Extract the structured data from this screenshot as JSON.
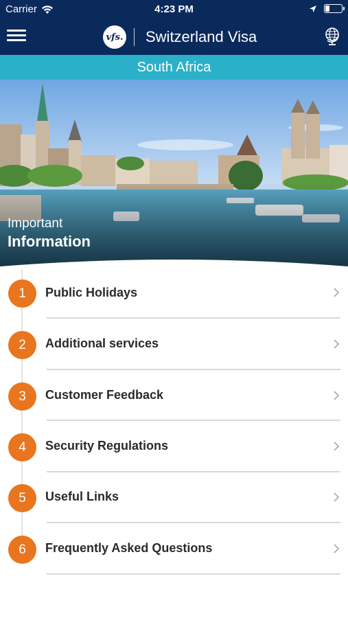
{
  "status_bar": {
    "carrier": "Carrier",
    "time": "4:23 PM"
  },
  "header": {
    "logo_text": "vfs.",
    "title": "Switzerland Visa",
    "menu_icon": "hamburger-menu-icon",
    "globe_icon": "globe-icon"
  },
  "country": "South Africa",
  "hero": {
    "subtitle": "Important",
    "title": "Information"
  },
  "items": [
    {
      "number": "1",
      "label": "Public Holidays"
    },
    {
      "number": "2",
      "label": "Additional services"
    },
    {
      "number": "3",
      "label": "Customer Feedback"
    },
    {
      "number": "4",
      "label": "Security Regulations"
    },
    {
      "number": "5",
      "label": "Useful Links"
    },
    {
      "number": "6",
      "label": "Frequently Asked Questions"
    }
  ],
  "colors": {
    "header": "#0b2a5c",
    "country_bar": "#2ab1c9",
    "badge": "#e9751e"
  }
}
